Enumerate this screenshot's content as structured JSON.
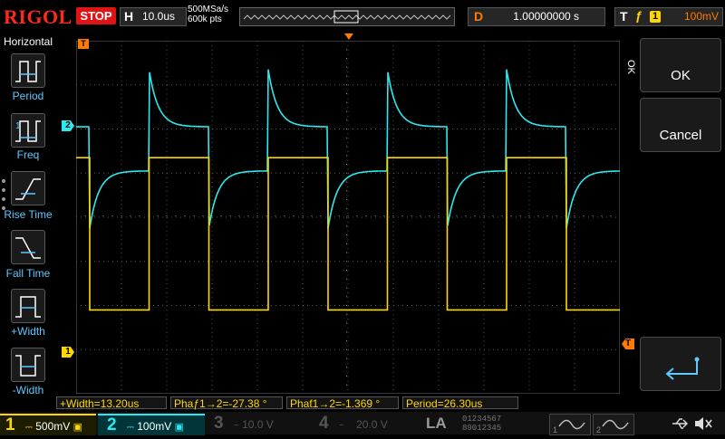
{
  "top": {
    "brand": "RIGOL",
    "run_state": "STOP",
    "horizontal_key": "H",
    "timebase": "10.0us",
    "sample_rate": "500MSa/s",
    "memory_depth": "600k pts",
    "delay_key": "D",
    "delay_value": "1.00000000 s",
    "trigger_key": "T",
    "trigger_edge": "ƒ",
    "trigger_source": "1",
    "trigger_level": "100mV"
  },
  "left_menu": {
    "title": "Horizontal",
    "items": [
      {
        "label": "Period"
      },
      {
        "label": "Freq"
      },
      {
        "label": "Rise Time"
      },
      {
        "label": "Fall Time"
      },
      {
        "label": "+Width"
      },
      {
        "label": "-Width"
      }
    ]
  },
  "right_menu": {
    "ok_side_label": "OK",
    "ok_button": "OK",
    "cancel_button": "Cancel"
  },
  "markers": {
    "ch1_marker": "1",
    "ch2_marker": "2",
    "trigger_level_marker": "T",
    "trigger_pos_marker": "T"
  },
  "measurements": [
    "+Width=13.20us",
    "Phaƒ1→2=-27.38 °",
    "Phaƭ1→2=-1.369 °",
    "Period=26.30us"
  ],
  "channels": [
    {
      "num": "1",
      "coupling": "⎓",
      "scale": "500mV",
      "active": true
    },
    {
      "num": "2",
      "coupling": "⎓",
      "scale": "100mV",
      "active": true
    },
    {
      "num": "3",
      "coupling": "~",
      "scale": "10.0 V",
      "active": false
    },
    {
      "num": "4",
      "coupling": "~",
      "scale": "20.0 V",
      "active": false
    }
  ],
  "la_label": "LA",
  "la_digits_row1": "01234567",
  "la_digits_row2": "89012345",
  "colors": {
    "ch1": "#ffd700",
    "ch2": "#2ee8f0",
    "trigger": "#ff7a00",
    "brand": "#ff2a1a",
    "stop": "#e01414"
  },
  "waveform": {
    "ch1_high_level_div": 1.35,
    "ch1_low_level_div": -2.1,
    "period_us": 26.3,
    "positive_width_us": 13.2,
    "ch2_overshoot_amplitude_div": 1.3,
    "ch2_settled_high_div": 1.95,
    "ch2_settled_low_div": 2.95
  }
}
